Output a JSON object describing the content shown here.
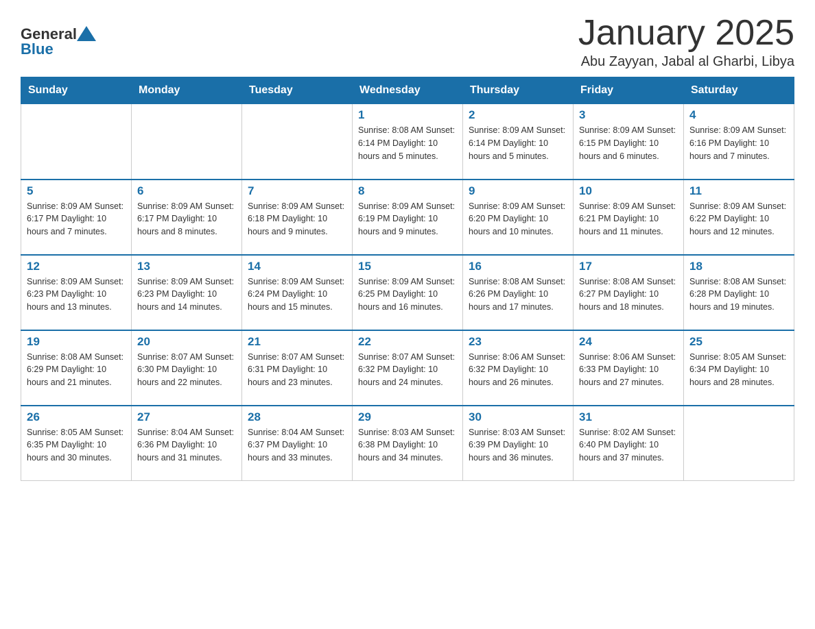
{
  "header": {
    "logo_general": "General",
    "logo_blue": "Blue",
    "title": "January 2025",
    "subtitle": "Abu Zayyan, Jabal al Gharbi, Libya"
  },
  "days_of_week": [
    "Sunday",
    "Monday",
    "Tuesday",
    "Wednesday",
    "Thursday",
    "Friday",
    "Saturday"
  ],
  "weeks": [
    [
      {
        "day": "",
        "info": ""
      },
      {
        "day": "",
        "info": ""
      },
      {
        "day": "",
        "info": ""
      },
      {
        "day": "1",
        "info": "Sunrise: 8:08 AM\nSunset: 6:14 PM\nDaylight: 10 hours\nand 5 minutes."
      },
      {
        "day": "2",
        "info": "Sunrise: 8:09 AM\nSunset: 6:14 PM\nDaylight: 10 hours\nand 5 minutes."
      },
      {
        "day": "3",
        "info": "Sunrise: 8:09 AM\nSunset: 6:15 PM\nDaylight: 10 hours\nand 6 minutes."
      },
      {
        "day": "4",
        "info": "Sunrise: 8:09 AM\nSunset: 6:16 PM\nDaylight: 10 hours\nand 7 minutes."
      }
    ],
    [
      {
        "day": "5",
        "info": "Sunrise: 8:09 AM\nSunset: 6:17 PM\nDaylight: 10 hours\nand 7 minutes."
      },
      {
        "day": "6",
        "info": "Sunrise: 8:09 AM\nSunset: 6:17 PM\nDaylight: 10 hours\nand 8 minutes."
      },
      {
        "day": "7",
        "info": "Sunrise: 8:09 AM\nSunset: 6:18 PM\nDaylight: 10 hours\nand 9 minutes."
      },
      {
        "day": "8",
        "info": "Sunrise: 8:09 AM\nSunset: 6:19 PM\nDaylight: 10 hours\nand 9 minutes."
      },
      {
        "day": "9",
        "info": "Sunrise: 8:09 AM\nSunset: 6:20 PM\nDaylight: 10 hours\nand 10 minutes."
      },
      {
        "day": "10",
        "info": "Sunrise: 8:09 AM\nSunset: 6:21 PM\nDaylight: 10 hours\nand 11 minutes."
      },
      {
        "day": "11",
        "info": "Sunrise: 8:09 AM\nSunset: 6:22 PM\nDaylight: 10 hours\nand 12 minutes."
      }
    ],
    [
      {
        "day": "12",
        "info": "Sunrise: 8:09 AM\nSunset: 6:23 PM\nDaylight: 10 hours\nand 13 minutes."
      },
      {
        "day": "13",
        "info": "Sunrise: 8:09 AM\nSunset: 6:23 PM\nDaylight: 10 hours\nand 14 minutes."
      },
      {
        "day": "14",
        "info": "Sunrise: 8:09 AM\nSunset: 6:24 PM\nDaylight: 10 hours\nand 15 minutes."
      },
      {
        "day": "15",
        "info": "Sunrise: 8:09 AM\nSunset: 6:25 PM\nDaylight: 10 hours\nand 16 minutes."
      },
      {
        "day": "16",
        "info": "Sunrise: 8:08 AM\nSunset: 6:26 PM\nDaylight: 10 hours\nand 17 minutes."
      },
      {
        "day": "17",
        "info": "Sunrise: 8:08 AM\nSunset: 6:27 PM\nDaylight: 10 hours\nand 18 minutes."
      },
      {
        "day": "18",
        "info": "Sunrise: 8:08 AM\nSunset: 6:28 PM\nDaylight: 10 hours\nand 19 minutes."
      }
    ],
    [
      {
        "day": "19",
        "info": "Sunrise: 8:08 AM\nSunset: 6:29 PM\nDaylight: 10 hours\nand 21 minutes."
      },
      {
        "day": "20",
        "info": "Sunrise: 8:07 AM\nSunset: 6:30 PM\nDaylight: 10 hours\nand 22 minutes."
      },
      {
        "day": "21",
        "info": "Sunrise: 8:07 AM\nSunset: 6:31 PM\nDaylight: 10 hours\nand 23 minutes."
      },
      {
        "day": "22",
        "info": "Sunrise: 8:07 AM\nSunset: 6:32 PM\nDaylight: 10 hours\nand 24 minutes."
      },
      {
        "day": "23",
        "info": "Sunrise: 8:06 AM\nSunset: 6:32 PM\nDaylight: 10 hours\nand 26 minutes."
      },
      {
        "day": "24",
        "info": "Sunrise: 8:06 AM\nSunset: 6:33 PM\nDaylight: 10 hours\nand 27 minutes."
      },
      {
        "day": "25",
        "info": "Sunrise: 8:05 AM\nSunset: 6:34 PM\nDaylight: 10 hours\nand 28 minutes."
      }
    ],
    [
      {
        "day": "26",
        "info": "Sunrise: 8:05 AM\nSunset: 6:35 PM\nDaylight: 10 hours\nand 30 minutes."
      },
      {
        "day": "27",
        "info": "Sunrise: 8:04 AM\nSunset: 6:36 PM\nDaylight: 10 hours\nand 31 minutes."
      },
      {
        "day": "28",
        "info": "Sunrise: 8:04 AM\nSunset: 6:37 PM\nDaylight: 10 hours\nand 33 minutes."
      },
      {
        "day": "29",
        "info": "Sunrise: 8:03 AM\nSunset: 6:38 PM\nDaylight: 10 hours\nand 34 minutes."
      },
      {
        "day": "30",
        "info": "Sunrise: 8:03 AM\nSunset: 6:39 PM\nDaylight: 10 hours\nand 36 minutes."
      },
      {
        "day": "31",
        "info": "Sunrise: 8:02 AM\nSunset: 6:40 PM\nDaylight: 10 hours\nand 37 minutes."
      },
      {
        "day": "",
        "info": ""
      }
    ]
  ]
}
